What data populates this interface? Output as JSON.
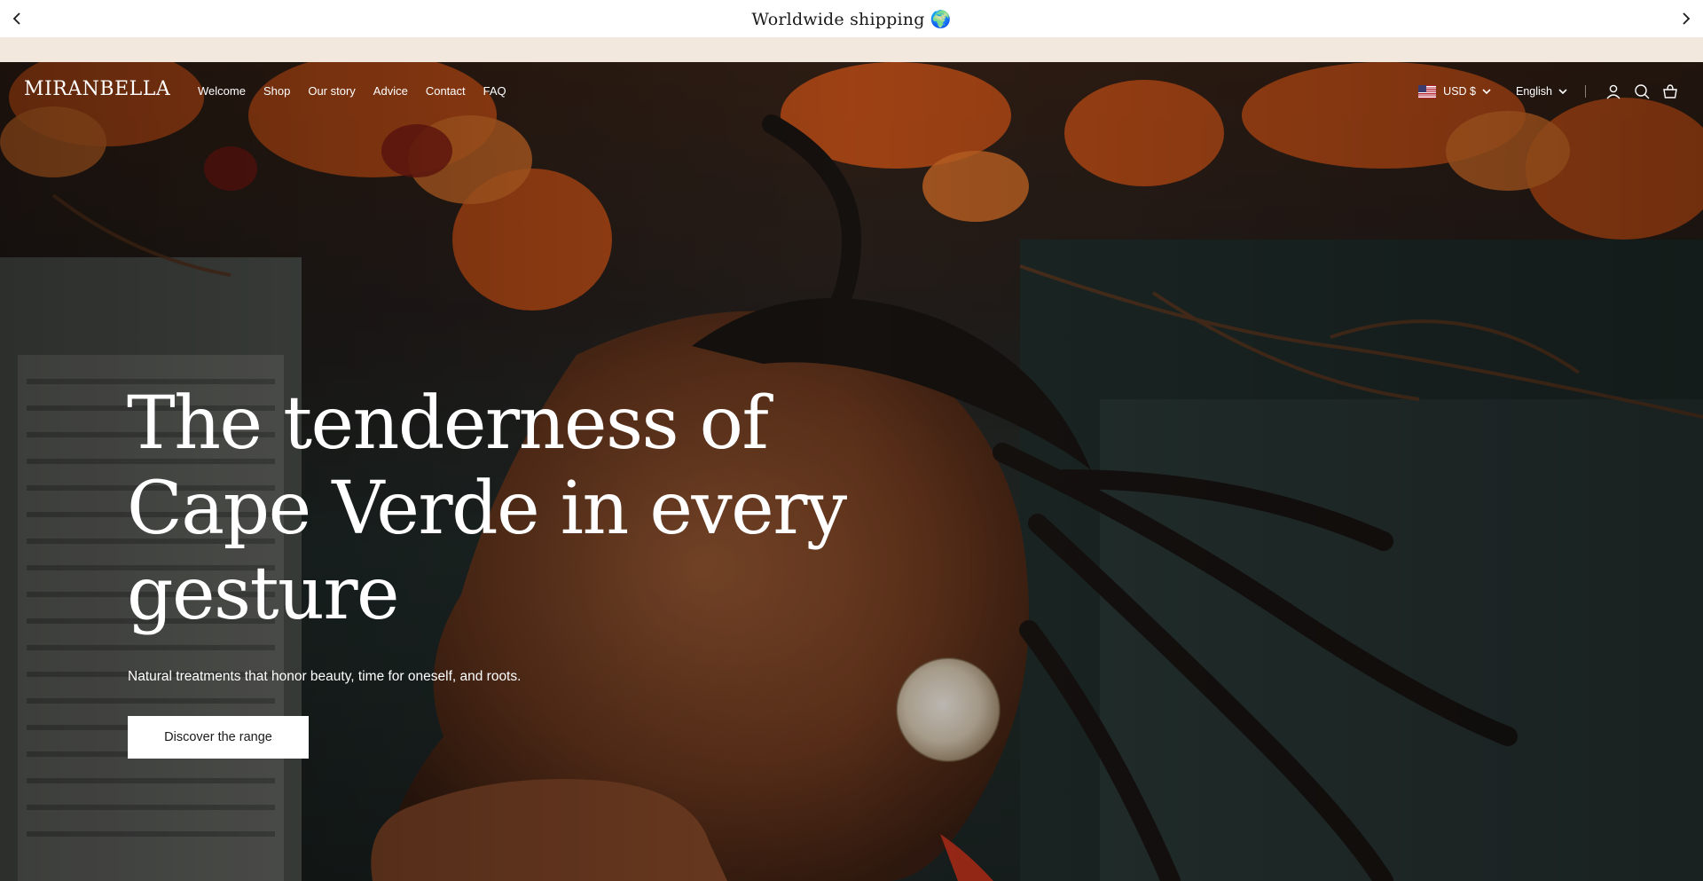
{
  "announcement": {
    "text": "Worldwide shipping 🌍",
    "prev_icon": "chevron-left-icon",
    "next_icon": "chevron-right-icon"
  },
  "header": {
    "logo": "MIRANBELLA",
    "nav": [
      "Welcome",
      "Shop",
      "Our story",
      "Advice",
      "Contact",
      "FAQ"
    ],
    "currency": "USD $",
    "currency_flag": "us-flag-icon",
    "language": "English",
    "icons": [
      "account-icon",
      "search-icon",
      "cart-icon"
    ]
  },
  "hero": {
    "headline": "The tenderness of Cape Verde in every gesture",
    "subtitle": "Natural treatments that honor beauty, time for oneself, and roots.",
    "cta_label": "Discover the range"
  },
  "colors": {
    "announcement_bg": "#ffffff",
    "strip_bg": "#f3e8de",
    "text_on_hero": "#ffffff",
    "cta_bg": "#ffffff",
    "cta_text": "#1a1a1a"
  }
}
